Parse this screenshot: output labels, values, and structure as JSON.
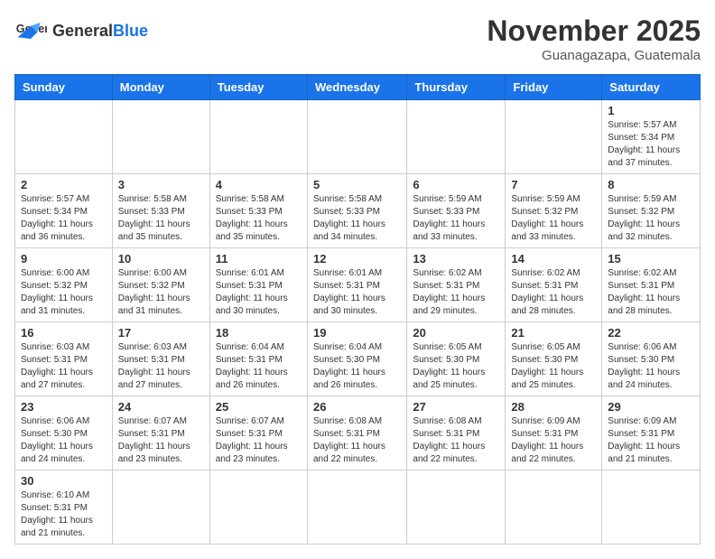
{
  "header": {
    "logo_general": "General",
    "logo_blue": "Blue",
    "month": "November 2025",
    "location": "Guanagazapa, Guatemala"
  },
  "weekdays": [
    "Sunday",
    "Monday",
    "Tuesday",
    "Wednesday",
    "Thursday",
    "Friday",
    "Saturday"
  ],
  "weeks": [
    [
      {
        "day": "",
        "info": ""
      },
      {
        "day": "",
        "info": ""
      },
      {
        "day": "",
        "info": ""
      },
      {
        "day": "",
        "info": ""
      },
      {
        "day": "",
        "info": ""
      },
      {
        "day": "",
        "info": ""
      },
      {
        "day": "1",
        "info": "Sunrise: 5:57 AM\nSunset: 5:34 PM\nDaylight: 11 hours\nand 37 minutes."
      }
    ],
    [
      {
        "day": "2",
        "info": "Sunrise: 5:57 AM\nSunset: 5:34 PM\nDaylight: 11 hours\nand 36 minutes."
      },
      {
        "day": "3",
        "info": "Sunrise: 5:58 AM\nSunset: 5:33 PM\nDaylight: 11 hours\nand 35 minutes."
      },
      {
        "day": "4",
        "info": "Sunrise: 5:58 AM\nSunset: 5:33 PM\nDaylight: 11 hours\nand 35 minutes."
      },
      {
        "day": "5",
        "info": "Sunrise: 5:58 AM\nSunset: 5:33 PM\nDaylight: 11 hours\nand 34 minutes."
      },
      {
        "day": "6",
        "info": "Sunrise: 5:59 AM\nSunset: 5:33 PM\nDaylight: 11 hours\nand 33 minutes."
      },
      {
        "day": "7",
        "info": "Sunrise: 5:59 AM\nSunset: 5:32 PM\nDaylight: 11 hours\nand 33 minutes."
      },
      {
        "day": "8",
        "info": "Sunrise: 5:59 AM\nSunset: 5:32 PM\nDaylight: 11 hours\nand 32 minutes."
      }
    ],
    [
      {
        "day": "9",
        "info": "Sunrise: 6:00 AM\nSunset: 5:32 PM\nDaylight: 11 hours\nand 31 minutes."
      },
      {
        "day": "10",
        "info": "Sunrise: 6:00 AM\nSunset: 5:32 PM\nDaylight: 11 hours\nand 31 minutes."
      },
      {
        "day": "11",
        "info": "Sunrise: 6:01 AM\nSunset: 5:31 PM\nDaylight: 11 hours\nand 30 minutes."
      },
      {
        "day": "12",
        "info": "Sunrise: 6:01 AM\nSunset: 5:31 PM\nDaylight: 11 hours\nand 30 minutes."
      },
      {
        "day": "13",
        "info": "Sunrise: 6:02 AM\nSunset: 5:31 PM\nDaylight: 11 hours\nand 29 minutes."
      },
      {
        "day": "14",
        "info": "Sunrise: 6:02 AM\nSunset: 5:31 PM\nDaylight: 11 hours\nand 28 minutes."
      },
      {
        "day": "15",
        "info": "Sunrise: 6:02 AM\nSunset: 5:31 PM\nDaylight: 11 hours\nand 28 minutes."
      }
    ],
    [
      {
        "day": "16",
        "info": "Sunrise: 6:03 AM\nSunset: 5:31 PM\nDaylight: 11 hours\nand 27 minutes."
      },
      {
        "day": "17",
        "info": "Sunrise: 6:03 AM\nSunset: 5:31 PM\nDaylight: 11 hours\nand 27 minutes."
      },
      {
        "day": "18",
        "info": "Sunrise: 6:04 AM\nSunset: 5:31 PM\nDaylight: 11 hours\nand 26 minutes."
      },
      {
        "day": "19",
        "info": "Sunrise: 6:04 AM\nSunset: 5:30 PM\nDaylight: 11 hours\nand 26 minutes."
      },
      {
        "day": "20",
        "info": "Sunrise: 6:05 AM\nSunset: 5:30 PM\nDaylight: 11 hours\nand 25 minutes."
      },
      {
        "day": "21",
        "info": "Sunrise: 6:05 AM\nSunset: 5:30 PM\nDaylight: 11 hours\nand 25 minutes."
      },
      {
        "day": "22",
        "info": "Sunrise: 6:06 AM\nSunset: 5:30 PM\nDaylight: 11 hours\nand 24 minutes."
      }
    ],
    [
      {
        "day": "23",
        "info": "Sunrise: 6:06 AM\nSunset: 5:30 PM\nDaylight: 11 hours\nand 24 minutes."
      },
      {
        "day": "24",
        "info": "Sunrise: 6:07 AM\nSunset: 5:31 PM\nDaylight: 11 hours\nand 23 minutes."
      },
      {
        "day": "25",
        "info": "Sunrise: 6:07 AM\nSunset: 5:31 PM\nDaylight: 11 hours\nand 23 minutes."
      },
      {
        "day": "26",
        "info": "Sunrise: 6:08 AM\nSunset: 5:31 PM\nDaylight: 11 hours\nand 22 minutes."
      },
      {
        "day": "27",
        "info": "Sunrise: 6:08 AM\nSunset: 5:31 PM\nDaylight: 11 hours\nand 22 minutes."
      },
      {
        "day": "28",
        "info": "Sunrise: 6:09 AM\nSunset: 5:31 PM\nDaylight: 11 hours\nand 22 minutes."
      },
      {
        "day": "29",
        "info": "Sunrise: 6:09 AM\nSunset: 5:31 PM\nDaylight: 11 hours\nand 21 minutes."
      }
    ],
    [
      {
        "day": "30",
        "info": "Sunrise: 6:10 AM\nSunset: 5:31 PM\nDaylight: 11 hours\nand 21 minutes."
      },
      {
        "day": "",
        "info": ""
      },
      {
        "day": "",
        "info": ""
      },
      {
        "day": "",
        "info": ""
      },
      {
        "day": "",
        "info": ""
      },
      {
        "day": "",
        "info": ""
      },
      {
        "day": "",
        "info": ""
      }
    ]
  ]
}
